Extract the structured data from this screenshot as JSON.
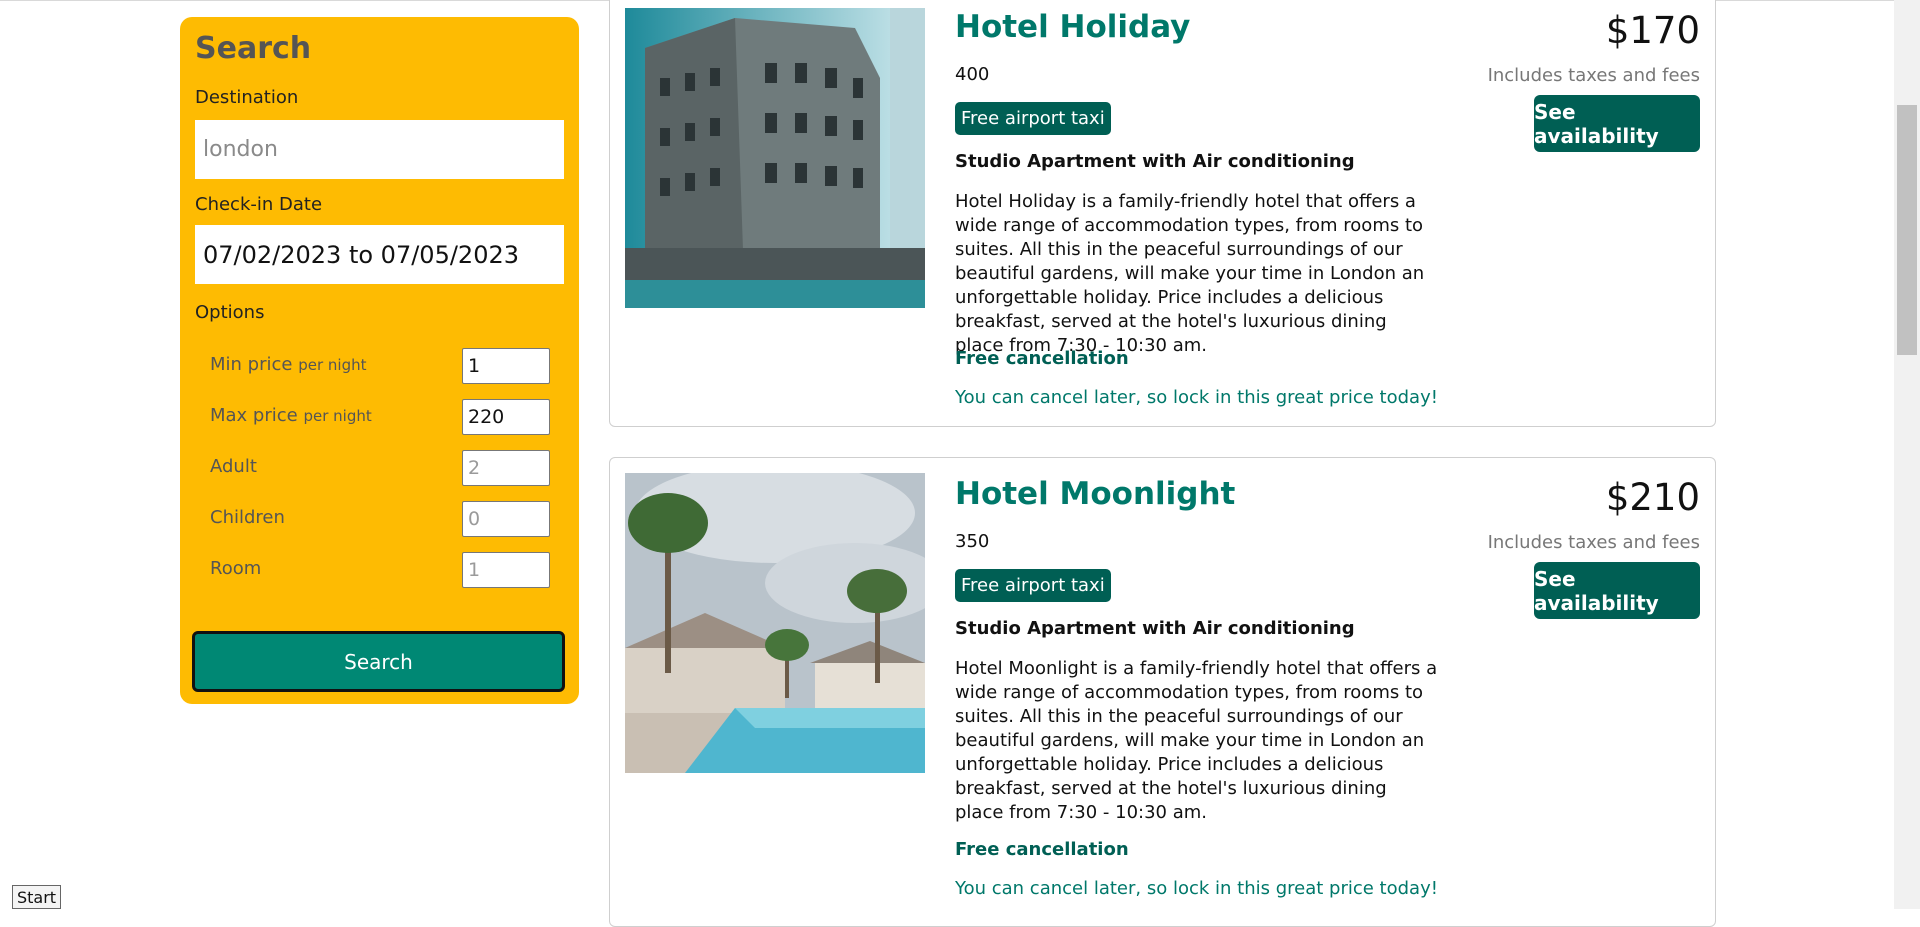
{
  "search": {
    "title": "Search",
    "destination_label": "Destination",
    "destination_placeholder": "london",
    "checkin_label": "Check-in Date",
    "checkin_value": "07/02/2023 to 07/05/2023",
    "options_label": "Options",
    "options": [
      {
        "label": "Min price",
        "suffix": "per night",
        "value": "1",
        "state": "filled"
      },
      {
        "label": "Max price",
        "suffix": "per night",
        "value": "220",
        "state": "filled"
      },
      {
        "label": "Adult",
        "suffix": "",
        "value": "2",
        "state": "placeholder"
      },
      {
        "label": "Children",
        "suffix": "",
        "value": "0",
        "state": "placeholder"
      },
      {
        "label": "Room",
        "suffix": "",
        "value": "1",
        "state": "placeholder"
      }
    ],
    "button_label": "Search"
  },
  "hotels": [
    {
      "name": "Hotel Holiday",
      "distance": "400",
      "badge": "Free airport taxi",
      "room": "Studio Apartment with Air conditioning",
      "description": "Hotel Holiday is a family-friendly hotel that offers a wide range of accommodation types, from rooms to suites. All this in the peaceful surroundings of our beautiful gardens, will make your time in London an unforgettable holiday. Price includes a delicious breakfast, served at the hotel's luxurious dining place from 7:30 - 10:30 am.",
      "cancel_title": "Free cancellation",
      "cancel_subtitle": "You can cancel later, so lock in this great price today!",
      "price": "$170",
      "tax_note": "Includes taxes and fees",
      "button_label": "See availability"
    },
    {
      "name": "Hotel Moonlight",
      "distance": "350",
      "badge": "Free airport taxi",
      "room": "Studio Apartment with Air conditioning",
      "description": "Hotel Moonlight is a family-friendly hotel that offers a wide range of accommodation types, from rooms to suites. All this in the peaceful surroundings of our beautiful gardens, will make your time in London an unforgettable holiday. Price includes a delicious breakfast, served at the hotel's luxurious dining place from 7:30 - 10:30 am.",
      "cancel_title": "Free cancellation",
      "cancel_subtitle": "You can cancel later, so lock in this great price today!",
      "price": "$210",
      "tax_note": "Includes taxes and fees",
      "button_label": "See availability"
    }
  ],
  "footer": {
    "start_label": "Start"
  },
  "colors": {
    "panel": "#febb02",
    "search_button": "#008874",
    "brand_dark": "#005f54",
    "brand_text": "#00786a"
  }
}
